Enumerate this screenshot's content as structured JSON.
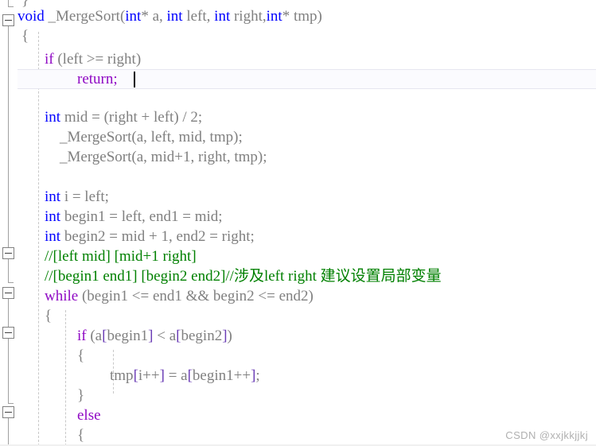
{
  "editor": {
    "language": "C++",
    "font": "serif",
    "line_height": 25,
    "colors": {
      "background": "#ffffff",
      "keyword": "#0000ff",
      "control_keyword": "#8f08c4",
      "identifier": "#808080",
      "bracket": "#6a3cb5",
      "comment": "#008000",
      "current_line_bg": "#fbfbfe",
      "gutter_line": "#a0a0a0",
      "indent_guide": "#c8c8c8",
      "watermark": "#b0b0b0"
    }
  },
  "watermark": {
    "text": "CSDN @xxjkkjjkj"
  },
  "code": {
    "lines": [
      {
        "index": 0,
        "text": "}",
        "indent": 1
      },
      {
        "index": 1,
        "text": "void _MergeSort(int* a, int left, int right,int* tmp)",
        "indent": 0
      },
      {
        "index": 2,
        "text": "{",
        "indent": 0
      },
      {
        "index": 3,
        "text": "    if (left >= right)",
        "indent": 1
      },
      {
        "index": 4,
        "text": "        return;",
        "indent": 2
      },
      {
        "index": 5,
        "text": "",
        "indent": 1
      },
      {
        "index": 6,
        "text": "    int mid = (right + left) / 2;",
        "indent": 1
      },
      {
        "index": 7,
        "text": "    _MergeSort(a, left, mid, tmp);",
        "indent": 1
      },
      {
        "index": 8,
        "text": "    _MergeSort(a, mid+1, right, tmp);",
        "indent": 1
      },
      {
        "index": 9,
        "text": "",
        "indent": 1
      },
      {
        "index": 10,
        "text": "    int i = left;",
        "indent": 1
      },
      {
        "index": 11,
        "text": "    int begin1 = left, end1 = mid;",
        "indent": 1
      },
      {
        "index": 12,
        "text": "    int begin2 = mid + 1, end2 = right;",
        "indent": 1
      },
      {
        "index": 13,
        "text": "    //[left mid] [mid+1 right]",
        "indent": 1
      },
      {
        "index": 14,
        "text": "    //[begin1 end1] [begin2 end2]//涉及left right 建议设置局部变量",
        "indent": 1
      },
      {
        "index": 15,
        "text": "    while (begin1 <= end1 && begin2 <= end2)",
        "indent": 1
      },
      {
        "index": 16,
        "text": "    {",
        "indent": 1
      },
      {
        "index": 17,
        "text": "        if (a[begin1] < a[begin2])",
        "indent": 2
      },
      {
        "index": 18,
        "text": "        {",
        "indent": 2
      },
      {
        "index": 19,
        "text": "            tmp[i++] = a[begin1++];",
        "indent": 3
      },
      {
        "index": 20,
        "text": "        }",
        "indent": 2
      },
      {
        "index": 21,
        "text": "        else",
        "indent": 2
      },
      {
        "index": 22,
        "text": "        {",
        "indent": 2
      }
    ],
    "current_line_index": 4,
    "caret_after": "return;"
  },
  "gutter": {
    "fold_markers": [
      {
        "name": "fold-void-mergesort",
        "line_index": 1,
        "state": "expanded"
      },
      {
        "name": "fold-comment-block",
        "line_index": 13,
        "state": "expanded"
      },
      {
        "name": "fold-while-block",
        "line_index": 15,
        "state": "expanded"
      },
      {
        "name": "fold-if-block",
        "line_index": 17,
        "state": "expanded"
      },
      {
        "name": "fold-else-block",
        "line_index": 21,
        "state": "expanded"
      }
    ]
  }
}
